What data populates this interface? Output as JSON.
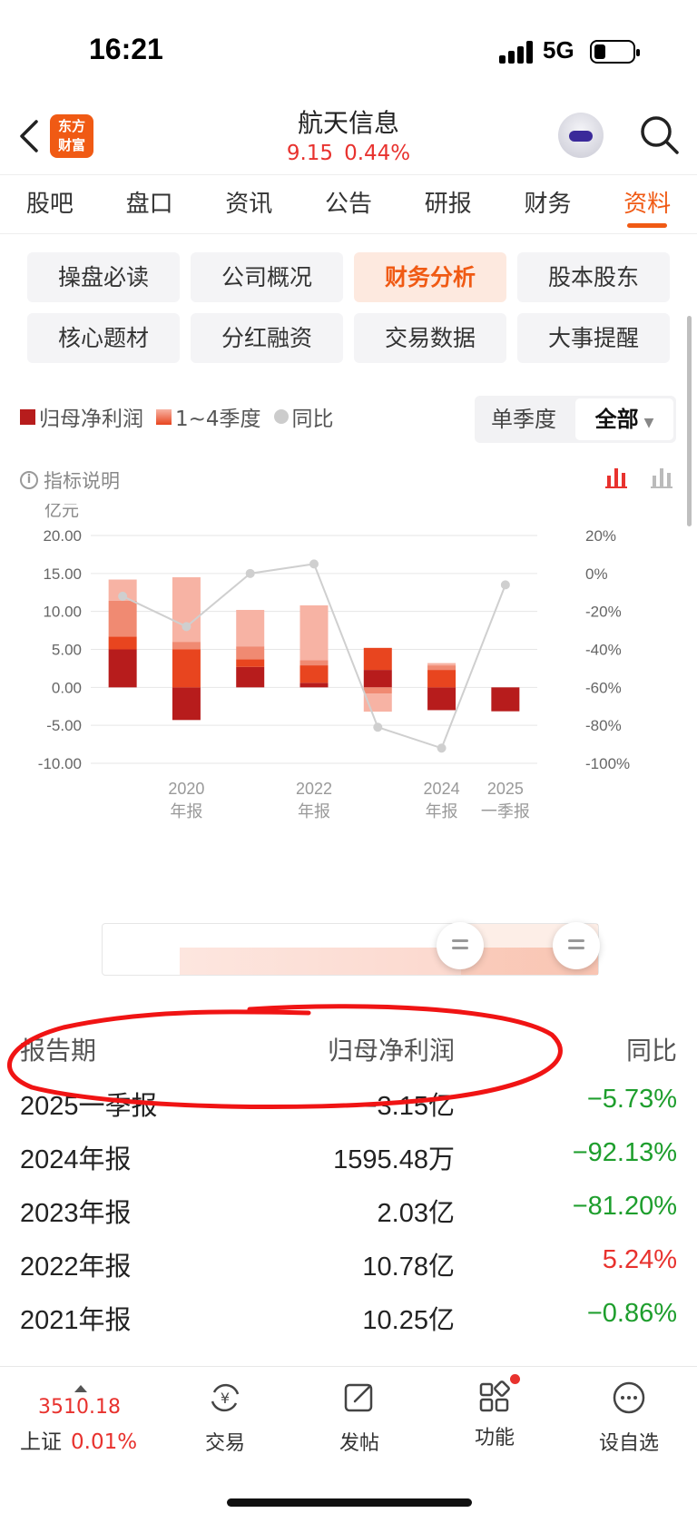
{
  "status_bar": {
    "time": "16:21",
    "network": "5G"
  },
  "header": {
    "logo": [
      "东方",
      "财富"
    ],
    "stock_name": "航天信息",
    "price": "9.15",
    "change_pct": "0.44%"
  },
  "tabs": [
    {
      "label": "股吧"
    },
    {
      "label": "盘口"
    },
    {
      "label": "资讯"
    },
    {
      "label": "公告"
    },
    {
      "label": "研报"
    },
    {
      "label": "财务"
    },
    {
      "label": "资料",
      "active": true
    }
  ],
  "sub_buttons": [
    {
      "label": "操盘必读"
    },
    {
      "label": "公司概况"
    },
    {
      "label": "财务分析",
      "active": true
    },
    {
      "label": "股本股东"
    },
    {
      "label": "核心题材"
    },
    {
      "label": "分红融资"
    },
    {
      "label": "交易数据"
    },
    {
      "label": "大事提醒"
    }
  ],
  "legend": {
    "net_profit": "归母净利润",
    "quarters": "1~4季度",
    "yoy": "同比"
  },
  "period_toggle": {
    "single_quarter": "单季度",
    "all": "全部",
    "selected": "全部"
  },
  "indicator_note": "指标说明",
  "colors": {
    "accent": "#f05a14",
    "up": "#e8322e",
    "down": "#1e9e2d",
    "bar_dark": "#b71c1c"
  },
  "chart_data": {
    "type": "bar",
    "unit_label": "亿元",
    "categories": [
      "",
      "2020\n年报",
      "",
      "2022\n年报",
      "",
      "2024\n年报",
      "2025\n一季报"
    ],
    "x_labels": [
      {
        "index": 1,
        "lines": [
          "2020",
          "年报"
        ]
      },
      {
        "index": 3,
        "lines": [
          "2022",
          "年报"
        ]
      },
      {
        "index": 5,
        "lines": [
          "2024",
          "年报"
        ]
      },
      {
        "index": 6,
        "lines": [
          "2025",
          "一季报"
        ]
      }
    ],
    "left_axis": {
      "ylim": [
        -10,
        20
      ],
      "ticks": [
        "20.00",
        "15.00",
        "10.00",
        "5.00",
        "0.00",
        "-5.00",
        "-10.00"
      ]
    },
    "right_axis": {
      "ylim": [
        -100,
        20
      ],
      "ticks": [
        "20%",
        "0%",
        "-20%",
        "-40%",
        "-60%",
        "-80%",
        "-100%"
      ]
    },
    "stacked_quarters": [
      {
        "q1": 5.0,
        "q2": 1.7,
        "q3": 4.7,
        "q4": 2.8
      },
      {
        "q1": -4.3,
        "q2": 5.0,
        "q3": 1.0,
        "q4": 8.5
      },
      {
        "q1": 2.7,
        "q2": 1.0,
        "q3": 1.7,
        "q4": 4.8
      },
      {
        "q1": 0.6,
        "q2": 2.3,
        "q3": 0.7,
        "q4": 7.2
      },
      {
        "q1": 2.3,
        "q2": 2.9,
        "q3": -0.8,
        "q4": -2.4
      },
      {
        "q1": -3.0,
        "q2": 2.3,
        "q3": 0.6,
        "q4": 0.3
      },
      {
        "q1": -3.15
      }
    ],
    "series": [
      {
        "name": "同比",
        "values": [
          -12,
          -28,
          0,
          5,
          -81,
          -92,
          -6
        ]
      }
    ]
  },
  "table": {
    "headers": {
      "period": "报告期",
      "net_profit": "归母净利润",
      "yoy": "同比"
    },
    "rows": [
      {
        "period": "2025一季报",
        "value": "−3.15亿",
        "yoy": "−5.73%",
        "sign": "neg"
      },
      {
        "period": "2024年报",
        "value": "1595.48万",
        "yoy": "−92.13%",
        "sign": "neg"
      },
      {
        "period": "2023年报",
        "value": "2.03亿",
        "yoy": "−81.20%",
        "sign": "neg"
      },
      {
        "period": "2022年报",
        "value": "10.78亿",
        "yoy": "5.24%",
        "sign": "pos"
      },
      {
        "period": "2021年报",
        "value": "10.25亿",
        "yoy": "−0.86%",
        "sign": "neg"
      }
    ]
  },
  "bottom_bar": {
    "index_value": "3510.18",
    "index_name": "上证",
    "index_pct": "0.01%",
    "items": [
      {
        "label": "交易",
        "icon": "yuan-cycle-icon"
      },
      {
        "label": "发帖",
        "icon": "edit-post-icon"
      },
      {
        "label": "功能",
        "icon": "grid-apps-icon"
      },
      {
        "label": "设自选",
        "icon": "more-circle-icon"
      }
    ]
  }
}
